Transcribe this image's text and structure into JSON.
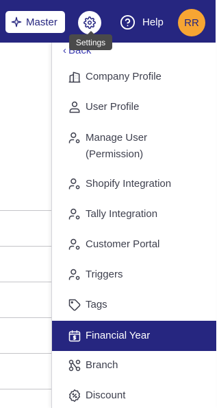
{
  "topbar": {
    "master_label": "Master",
    "help_label": "Help",
    "avatar_initials": "RR",
    "settings_tooltip": "Settings"
  },
  "menu": {
    "back_label": "Back",
    "items": [
      {
        "label": "Company Profile",
        "icon": "building-icon"
      },
      {
        "label": "User Profile",
        "icon": "user-icon"
      },
      {
        "label": "Manage User",
        "label_line2": "(Permission)",
        "icon": "user-gear-icon"
      },
      {
        "label": "Shopify Integration",
        "icon": "user-gear-icon"
      },
      {
        "label": "Tally Integration",
        "icon": "user-gear-icon"
      },
      {
        "label": "Customer Portal",
        "icon": "user-gear-icon"
      },
      {
        "label": "Triggers",
        "icon": "user-gear-icon"
      },
      {
        "label": "Tags",
        "icon": "tag-icon"
      },
      {
        "label": "Financial Year",
        "icon": "calendar-dollar-icon",
        "active": true
      },
      {
        "label": "Branch",
        "icon": "branch-icon"
      },
      {
        "label": "Discount",
        "icon": "discount-icon"
      }
    ]
  },
  "colors": {
    "nav_bg": "#262680",
    "accent": "#262680",
    "avatar_bg": "#f7a533",
    "tooltip_bg": "#4a4a4a"
  }
}
